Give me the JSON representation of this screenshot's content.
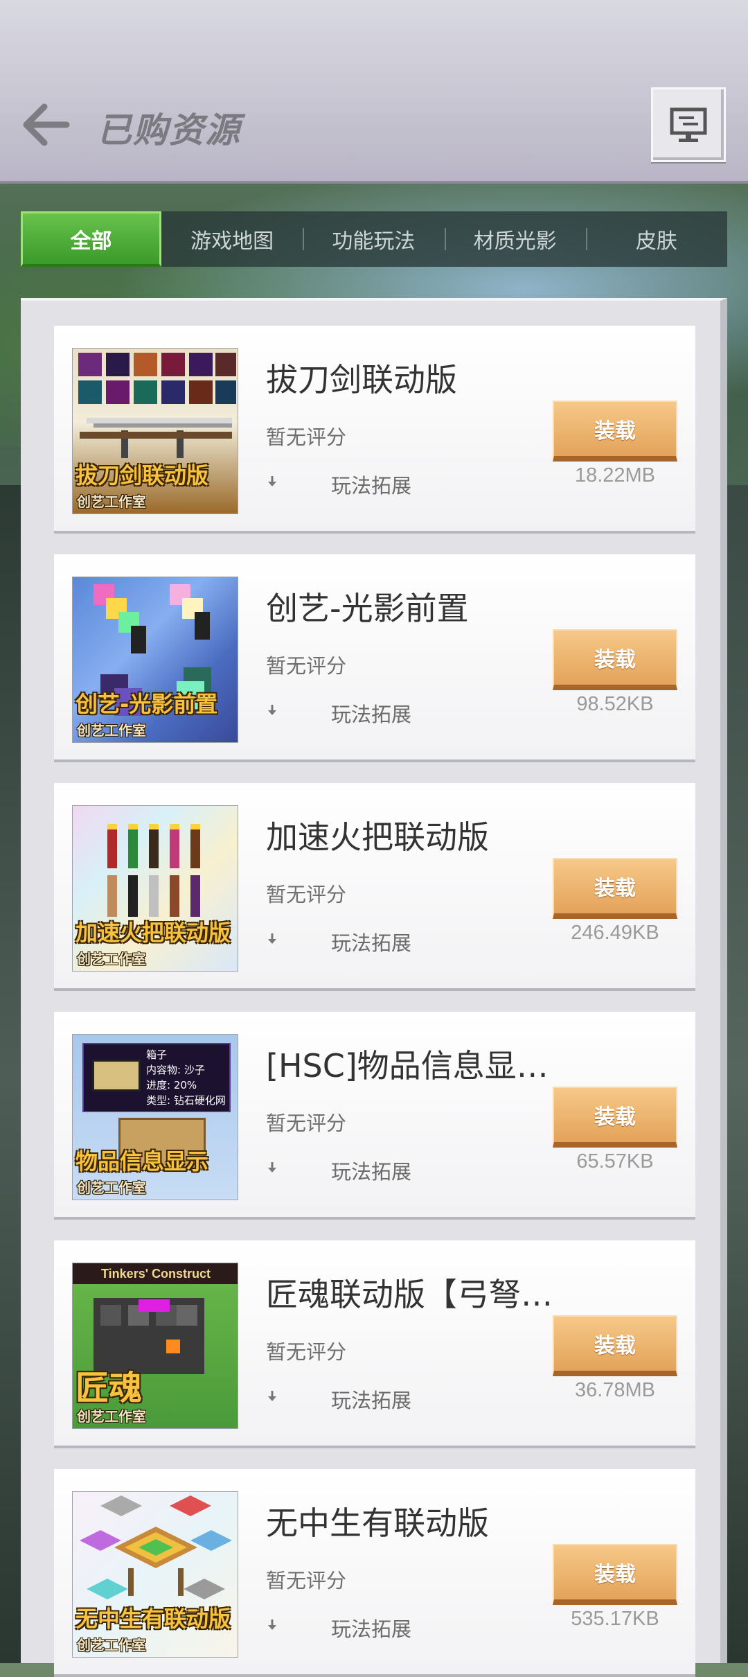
{
  "header": {
    "title": "已购资源"
  },
  "tabs": [
    {
      "label": "全部",
      "active": true
    },
    {
      "label": "游戏地图",
      "active": false
    },
    {
      "label": "功能玩法",
      "active": false
    },
    {
      "label": "材质光影",
      "active": false
    },
    {
      "label": "皮肤",
      "active": false
    }
  ],
  "items": [
    {
      "title": "拔刀剑联动版",
      "rating": "暂无评分",
      "category": "玩法拓展",
      "button": "装载",
      "size": "18.22MB",
      "thumb_caption": "拔刀剑联动版",
      "thumb_studio": "创艺工作室"
    },
    {
      "title": "创艺-光影前置",
      "rating": "暂无评分",
      "category": "玩法拓展",
      "button": "装载",
      "size": "98.52KB",
      "thumb_caption": "创艺-光影前置",
      "thumb_studio": "创艺工作室"
    },
    {
      "title": "加速火把联动版",
      "rating": "暂无评分",
      "category": "玩法拓展",
      "button": "装载",
      "size": "246.49KB",
      "thumb_caption": "加速火把联动版",
      "thumb_studio": "创艺工作室"
    },
    {
      "title": "[HSC]物品信息显…",
      "rating": "暂无评分",
      "category": "玩法拓展",
      "button": "装载",
      "size": "65.57KB",
      "thumb_caption": "物品信息显示",
      "thumb_studio": "创艺工作室",
      "thumb_tooltip": [
        "箱子",
        "内容物: 沙子",
        "进度: 20%",
        "类型: 钻石硬化网"
      ]
    },
    {
      "title": "匠魂联动版【弓弩…",
      "rating": "暂无评分",
      "category": "玩法拓展",
      "button": "装载",
      "size": "36.78MB",
      "thumb_caption": "匠魂",
      "thumb_studio": "创艺工作室",
      "thumb_banner": "Tinkers' Construct"
    },
    {
      "title": "无中生有联动版",
      "rating": "暂无评分",
      "category": "玩法拓展",
      "button": "装载",
      "size": "535.17KB",
      "thumb_caption": "无中生有联动版",
      "thumb_studio": "创艺工作室"
    }
  ]
}
